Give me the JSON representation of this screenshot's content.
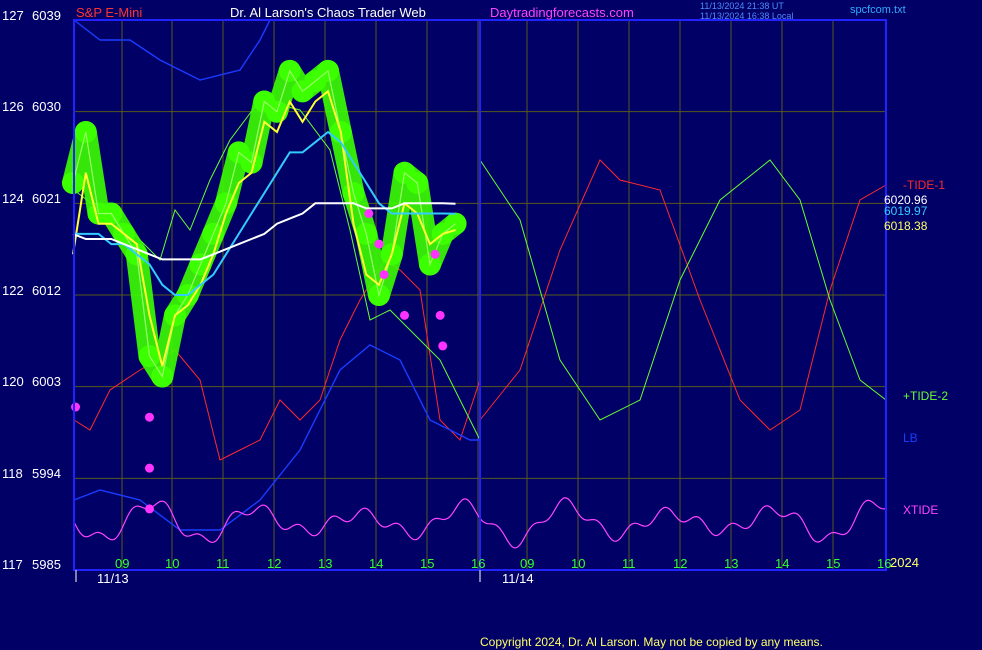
{
  "header": {
    "symbol": "S&P E-Mini",
    "site_title": "Dr. Al Larson's Chaos Trader Web",
    "site_url": "Daytradingforecasts.com",
    "timestamp_ut": "11/13/2024 21:38 UT",
    "timestamp_local": "11/13/2024 16:38 Local",
    "file_name": "spcfcom.txt"
  },
  "copyright": "Copyright 2024, Dr. Al Larson. May not be copied by any means.",
  "year_label": "2024",
  "colors": {
    "background": "#000066",
    "frame": "#2222ff",
    "grid": "#5a5a1e",
    "price": "#3cff00",
    "yellow_avg": "#ffff33",
    "cyan_avg": "#33ccff",
    "white_avg": "#ffffff",
    "tide1": "#ff2a2a",
    "tide2": "#66ff33",
    "lb": "#1a3cff",
    "xtide": "#ff44ff",
    "markers": "#ff33ff"
  },
  "chart_data": {
    "type": "line",
    "title": "",
    "xlabel": "",
    "ylabel": "",
    "left_axis_labels": [
      "127",
      "126",
      "124",
      "122",
      "120",
      "118",
      "117"
    ],
    "right_axis_values": [
      6039,
      6030,
      6021,
      6012,
      6003,
      5994,
      5985
    ],
    "ylim": [
      5985,
      6039
    ],
    "x_tick_labels": [
      "09",
      "10",
      "11",
      "12",
      "13",
      "14",
      "15",
      "16",
      "09",
      "10",
      "11",
      "12",
      "13",
      "14",
      "15",
      "16"
    ],
    "date_labels": [
      "11/13",
      "11/14"
    ],
    "last_values": {
      "white": "6020.96",
      "cyan": "6019.97",
      "yellow": "6018.38"
    },
    "legend": [
      "-TIDE-1",
      "+TIDE-2",
      "LB",
      "XTIDE"
    ],
    "x_hours": [
      8.5,
      8.75,
      9,
      9.25,
      9.5,
      9.75,
      10,
      10.25,
      10.5,
      10.75,
      11,
      11.25,
      11.5,
      11.75,
      12,
      12.25,
      12.5,
      12.75,
      13,
      13.25,
      13.5,
      13.75,
      14,
      14.25,
      14.5,
      14.75,
      15,
      15.25,
      15.5,
      15.75,
      16
    ],
    "series": [
      {
        "key": "price",
        "values": [
          6023,
          6028,
          6020,
          6020,
          6018,
          6016,
          6006,
          6004,
          6010,
          6012,
          6015,
          6018,
          6021,
          6026,
          6025,
          6031,
          6030,
          6034,
          6032,
          6033,
          6034,
          6028,
          6022,
          6018,
          6012,
          6016,
          6024,
          6023,
          6015,
          6018,
          6019
        ]
      },
      {
        "key": "yellow",
        "values": [
          6016,
          6024,
          6019,
          6019,
          6018,
          6017,
          6010,
          6005,
          6010,
          6011,
          6013,
          6016,
          6020,
          6023,
          6024,
          6029,
          6028,
          6031,
          6029,
          6031,
          6032,
          6028,
          6019,
          6014,
          6013,
          6016,
          6021,
          6020,
          6017,
          6018,
          6018.38
        ]
      },
      {
        "key": "cyan",
        "values": [
          6018,
          6018,
          6018,
          6017,
          6017,
          6016,
          6015,
          6013,
          6012,
          6012,
          6013,
          6014,
          6016,
          6018,
          6020,
          6022,
          6024,
          6026,
          6026,
          6027,
          6028,
          6027,
          6025,
          6023,
          6021,
          6020,
          6020,
          6020,
          6020,
          6020,
          6019.97
        ]
      },
      {
        "key": "white",
        "values": [
          6018,
          6017.5,
          6017.5,
          6017.5,
          6017,
          6016.5,
          6016,
          6015.5,
          6015.5,
          6015.5,
          6015.5,
          6016,
          6016.5,
          6017,
          6017.5,
          6018,
          6019,
          6019.5,
          6020,
          6021,
          6021,
          6021,
          6021,
          6020.5,
          6020.5,
          6020.5,
          6021,
          6021,
          6021,
          6021,
          6020.96
        ]
      }
    ],
    "magenta_dots": [
      {
        "x": 8.55,
        "y": 6001
      },
      {
        "x": 10,
        "y": 6000
      },
      {
        "x": 10,
        "y": 5995
      },
      {
        "x": 10,
        "y": 5991
      },
      {
        "x": 14.3,
        "y": 6020
      },
      {
        "x": 14.5,
        "y": 6017
      },
      {
        "x": 14.6,
        "y": 6014
      },
      {
        "x": 15.0,
        "y": 6010
      },
      {
        "x": 15.6,
        "y": 6016
      },
      {
        "x": 15.7,
        "y": 6010
      },
      {
        "x": 15.75,
        "y": 6007
      }
    ]
  }
}
